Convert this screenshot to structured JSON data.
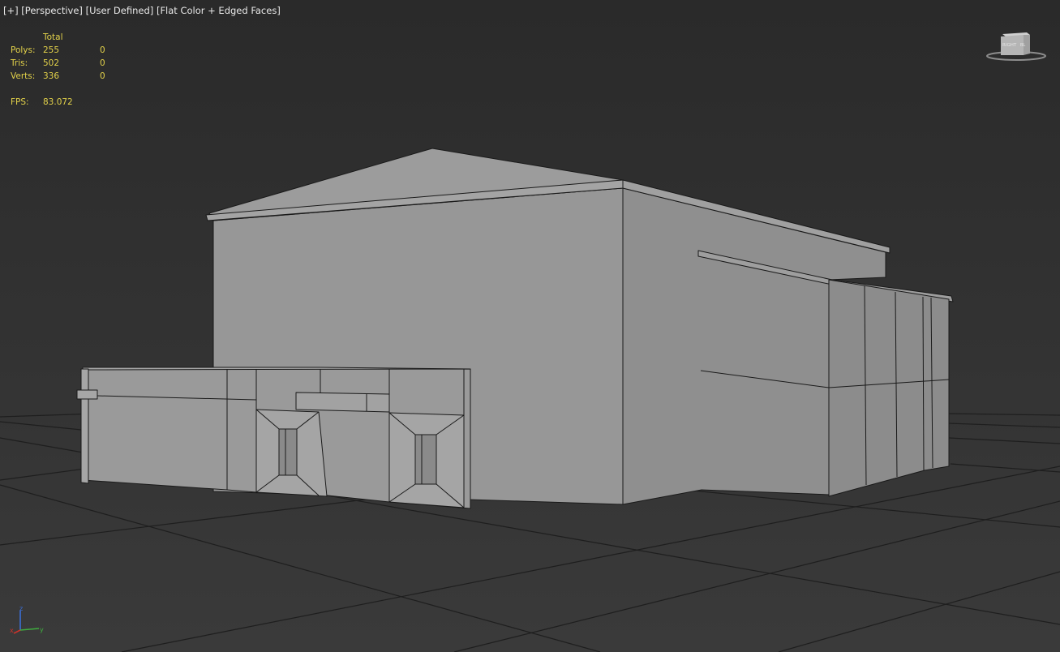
{
  "viewport": {
    "labels": [
      "+",
      "Perspective",
      "User Defined",
      "Flat Color + Edged Faces"
    ]
  },
  "stats": {
    "header": "Total",
    "rows": [
      {
        "label": "Polys:",
        "total": "255",
        "selected": "0"
      },
      {
        "label": "Tris:",
        "total": "502",
        "selected": "0"
      },
      {
        "label": "Verts:",
        "total": "336",
        "selected": "0"
      }
    ],
    "fps_label": "FPS:",
    "fps_value": "83.072"
  },
  "viewcube": {
    "face_label": "RIGHT",
    "edge_label": "BL"
  },
  "axis_tripod": {
    "x": "x",
    "y": "y",
    "z": "z"
  },
  "colors": {
    "stats_text": "#e3d24a",
    "label_text": "#e8e8e8",
    "model_face": "#989898",
    "edge": "#1a1a1a",
    "grid": "#1e1e1e",
    "axis_x": "#c8342c",
    "axis_y": "#3fae3f",
    "axis_z": "#3b6fd6"
  }
}
